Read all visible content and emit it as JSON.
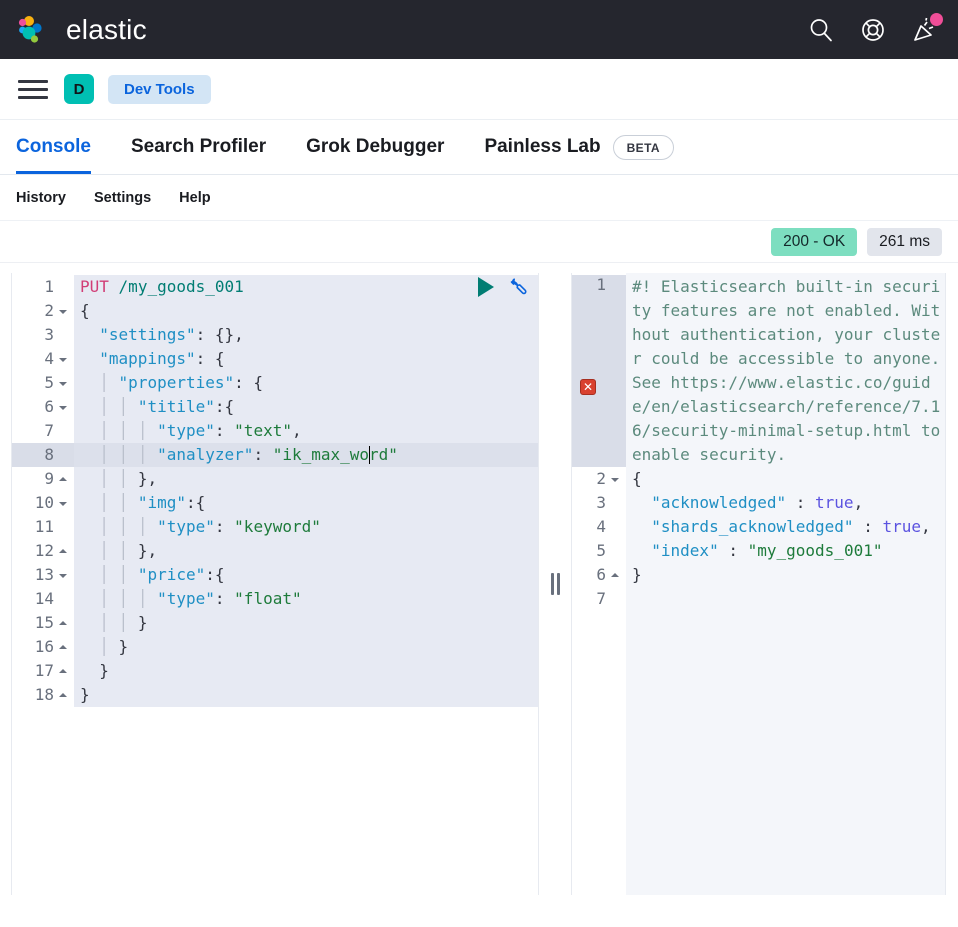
{
  "header": {
    "brand": "elastic",
    "icons": [
      {
        "name": "search-icon",
        "label": "Search"
      },
      {
        "name": "help-icon",
        "label": "Help"
      },
      {
        "name": "announcements-icon",
        "label": "What's new"
      }
    ],
    "notification_color": "#F04E98"
  },
  "breadcrumbs": {
    "menu_label": "Toggle primary navigation",
    "space_initial": "D",
    "space_color": "#00BFB3",
    "badge_label": "Dev Tools",
    "badge_color": "#D3E5F5"
  },
  "tabs": [
    {
      "label": "Console",
      "active": true
    },
    {
      "label": "Search Profiler",
      "active": false
    },
    {
      "label": "Grok Debugger",
      "active": false
    },
    {
      "label": "Painless Lab",
      "active": false,
      "pill": "BETA"
    }
  ],
  "submenu": [
    {
      "label": "History"
    },
    {
      "label": "Settings"
    },
    {
      "label": "Help"
    }
  ],
  "status": {
    "code": "200 - OK",
    "code_color": "#7DDEC0",
    "time": "261 ms",
    "time_color": "#E2E5EC"
  },
  "request_editor": {
    "play_label": "Click to send request",
    "wrench_label": "Open documentation",
    "cursor_line": 8,
    "lines": [
      {
        "n": 1,
        "fold": "",
        "text": "PUT /my_goods_001"
      },
      {
        "n": 2,
        "fold": "down",
        "text": "{"
      },
      {
        "n": 3,
        "fold": "",
        "text": "  \"settings\": {},"
      },
      {
        "n": 4,
        "fold": "down",
        "text": "  \"mappings\": {"
      },
      {
        "n": 5,
        "fold": "down",
        "text": "    \"properties\": {"
      },
      {
        "n": 6,
        "fold": "down",
        "text": "      \"titile\":{"
      },
      {
        "n": 7,
        "fold": "",
        "text": "        \"type\": \"text\","
      },
      {
        "n": 8,
        "fold": "",
        "text": "        \"analyzer\": \"ik_max_word\""
      },
      {
        "n": 9,
        "fold": "up",
        "text": "      },"
      },
      {
        "n": 10,
        "fold": "down",
        "text": "      \"img\":{"
      },
      {
        "n": 11,
        "fold": "",
        "text": "        \"type\": \"keyword\""
      },
      {
        "n": 12,
        "fold": "up",
        "text": "      },"
      },
      {
        "n": 13,
        "fold": "down",
        "text": "      \"price\":{"
      },
      {
        "n": 14,
        "fold": "",
        "text": "        \"type\": \"float\""
      },
      {
        "n": 15,
        "fold": "up",
        "text": "      }"
      },
      {
        "n": 16,
        "fold": "up",
        "text": "    }"
      },
      {
        "n": 17,
        "fold": "up",
        "text": "  }"
      },
      {
        "n": 18,
        "fold": "up",
        "text": "}"
      }
    ]
  },
  "response_editor": {
    "error_marker": "✕",
    "warning": "#! Elasticsearch built-in security features are not enabled. Without authentication, your cluster could be accessible to anyone. See https://www.elastic.co/guide/en/elasticsearch/reference/7.16/security-minimal-setup.html to enable security.",
    "lines": [
      {
        "n": 2,
        "fold": "down",
        "text": "{"
      },
      {
        "n": 3,
        "fold": "",
        "text": "  \"acknowledged\" : true,"
      },
      {
        "n": 4,
        "fold": "",
        "text": "  \"shards_acknowledged\" : true,"
      },
      {
        "n": 5,
        "fold": "",
        "text": "  \"index\" : \"my_goods_001\""
      },
      {
        "n": 6,
        "fold": "up",
        "text": "}"
      },
      {
        "n": 7,
        "fold": "",
        "text": ""
      }
    ]
  },
  "splitter": {
    "label": "Drag to resize panels"
  }
}
